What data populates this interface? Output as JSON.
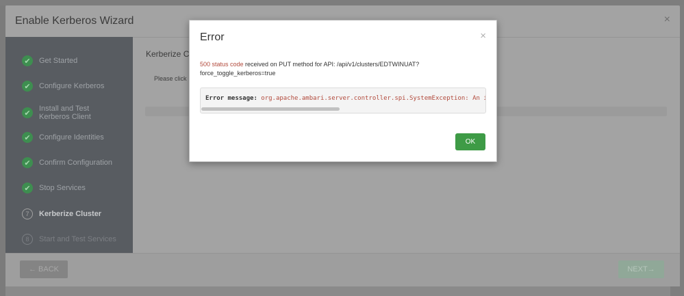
{
  "wizard": {
    "title": "Enable Kerberos Wizard",
    "close_glyph": "×",
    "steps": [
      {
        "label": "Get Started",
        "state": "done",
        "marker": "✔"
      },
      {
        "label": "Configure Kerberos",
        "state": "done",
        "marker": "✔"
      },
      {
        "label": "Install and Test Kerberos Client",
        "state": "done",
        "marker": "✔"
      },
      {
        "label": "Configure Identities",
        "state": "done",
        "marker": "✔"
      },
      {
        "label": "Confirm Configuration",
        "state": "done",
        "marker": "✔"
      },
      {
        "label": "Stop Services",
        "state": "done",
        "marker": "✔"
      },
      {
        "label": "Kerberize Cluster",
        "state": "active",
        "marker": "7"
      },
      {
        "label": "Start and Test Services",
        "state": "pending",
        "marker": "8"
      }
    ],
    "content_title": "Kerberize Cl",
    "content_text": "Please click",
    "back_label": "← BACK",
    "next_label": "NEXT→"
  },
  "modal": {
    "title": "Error",
    "close_glyph": "×",
    "status_code": "500 status code",
    "message_rest": " received on PUT method for API: /api/v1/clusters/EDTWINUAT?",
    "message_line2": "force_toggle_kerberos=true",
    "error_label": "Error message:",
    "error_value": " org.apache.ambari.server.controller.spi.SystemException: An in",
    "ok_label": "OK"
  },
  "colors": {
    "ok_button": "#3e9b46",
    "step_done": "#3e8e50",
    "error_text": "#b24a3c"
  },
  "icons": {
    "step_done": "check-icon",
    "close": "close-icon"
  }
}
